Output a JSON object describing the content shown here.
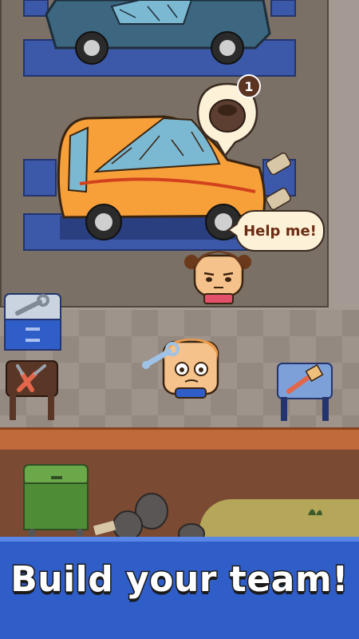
{
  "speech_bubble": {
    "text": "Help me!"
  },
  "request_badge": {
    "count": "1"
  },
  "banner": {
    "title": "Build your team!"
  },
  "icons": {
    "car_top": "blue-broken-car-icon",
    "car_main": "orange-broken-car-icon",
    "request": "tire-icon",
    "customer": "customer-girl-icon",
    "mechanic": "mechanic-boy-icon",
    "wrench": "wrench-icon",
    "station_wrench": "wrench-bench-icon",
    "station_pliers": "pliers-bench-icon",
    "station_paint": "paintbrush-bench-icon",
    "dumpster": "green-dumpster-icon",
    "trash": "trash-bag-icon"
  },
  "colors": {
    "accent": "#2f5ec8",
    "car_main": "#f7a03a",
    "car_top": "#3d6680"
  }
}
